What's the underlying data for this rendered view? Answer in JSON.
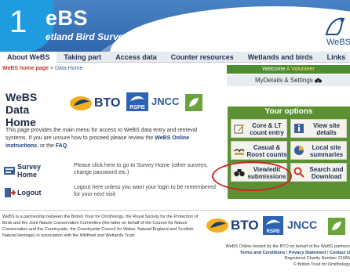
{
  "step_badge": "1",
  "header": {
    "brand": "eBS",
    "subtitle": "etland Bird Survey",
    "corner_logo_text": "WeBS"
  },
  "nav": {
    "items": [
      "About WeBS",
      "Taking part",
      "Access data",
      "Counter resources",
      "Wetlands and birds",
      "Links"
    ]
  },
  "breadcrumb": {
    "home": "WeBS home page",
    "separator": ">",
    "current": "Data Home"
  },
  "welcome": {
    "prefix": "Welcome",
    "user": "A Volunteer",
    "mydetails": "MyDetails & Settings"
  },
  "page_title": "WeBS Data Home",
  "logos": {
    "bto": "BTO",
    "rspb": "RSPB",
    "jncc": "JNCC"
  },
  "intro": {
    "text1": "This page provides the main menu for access to WeBS data entry and retrieval systems. If you are unsure how to proceed please review the ",
    "link1": "WeBS Online instructions",
    "text2": ", or the ",
    "link2": "FAQ",
    "text3": "."
  },
  "survey": {
    "label": "Survey Home",
    "desc": "Please click here to go to Survey Home (other surveys, change password etc.)"
  },
  "logout": {
    "label": "Logout",
    "desc": "Logout here unless you want your login to be remembered for your next visit"
  },
  "options": {
    "title": "Your options",
    "items": [
      {
        "label": "Core & LT count entry"
      },
      {
        "label": "View site details"
      },
      {
        "label": "Casual & Roost counts"
      },
      {
        "label": "Local site summaries"
      },
      {
        "label": "View/edit submissions"
      },
      {
        "label": "Search and Download"
      }
    ]
  },
  "footer": {
    "left": "WeBS is a partnership between the British Trust for Ornithology, the Royal Society for the Protection of Birds and the Joint Nature Conservation Committee (the latter on behalf of the Council for Nature Conservation and the Countryside, the Countryside Council for Wales, Natural England and Scottish Natural Heritage) in association with the Wildfowl and Wetlands Trust.",
    "right_line1": "WeBS Online hosted by the BTO on behalf of the WeBS partners",
    "right_terms": "Terms and Conditions",
    "right_privacy": "Privacy Statement",
    "right_contact": "Contact U",
    "right_sep": "|",
    "right_line3": "Registered Charity Number 21665",
    "right_line4": "© British Trust for Ornithology"
  },
  "colors": {
    "header_blue": "#2f67ad",
    "badge_blue": "#1f9be0",
    "options_green": "#5b9133",
    "highlight_red": "#d4202a"
  }
}
